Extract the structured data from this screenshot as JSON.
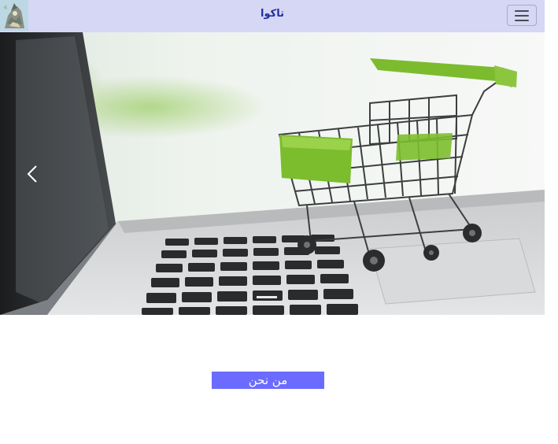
{
  "navbar": {
    "brand": "تاكوا",
    "logo_icon": "logo-icon",
    "toggler_icon": "hamburger-menu-icon",
    "background_color": "#d6d6f5",
    "brand_color": "#1e2f9e"
  },
  "carousel": {
    "image_subject": "shopping-cart-on-laptop-image",
    "prev_icon": "chevron-left-icon"
  },
  "about": {
    "button_label": "من نحن",
    "button_color": "#6b6cff"
  }
}
